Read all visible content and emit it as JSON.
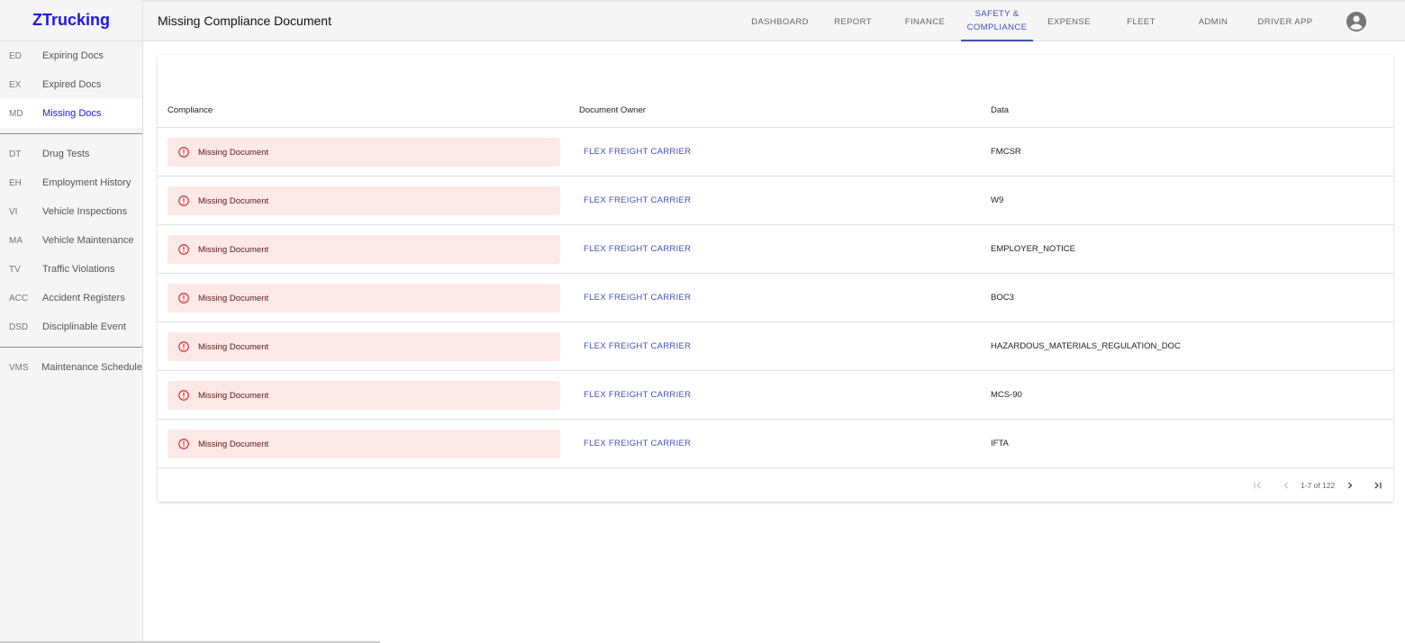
{
  "app": {
    "brand": "ZTrucking"
  },
  "header": {
    "title": "Missing Compliance Document",
    "nav": [
      {
        "label": "DASHBOARD"
      },
      {
        "label": "REPORT"
      },
      {
        "label": "FINANCE"
      },
      {
        "label": "SAFETY & COMPLIANCE",
        "line1": "SAFETY &",
        "line2": "COMPLIANCE",
        "active": true
      },
      {
        "label": "EXPENSE"
      },
      {
        "label": "FLEET"
      },
      {
        "label": "ADMIN"
      },
      {
        "label": "DRIVER APP"
      }
    ]
  },
  "sidebar": {
    "items": [
      {
        "abbr": "ED",
        "label": "Expiring Docs"
      },
      {
        "abbr": "EX",
        "label": "Expired Docs"
      },
      {
        "abbr": "MD",
        "label": "Missing Docs",
        "active": true
      },
      {
        "abbr": "DT",
        "label": "Drug Tests"
      },
      {
        "abbr": "EH",
        "label": "Employment History"
      },
      {
        "abbr": "VI",
        "label": "Vehicle Inspections"
      },
      {
        "abbr": "MA",
        "label": "Vehicle Maintenance"
      },
      {
        "abbr": "TV",
        "label": "Traffic Violations"
      },
      {
        "abbr": "ACC",
        "label": "Accident Registers"
      },
      {
        "abbr": "DSD",
        "label": "Disciplinable Event"
      },
      {
        "abbr": "VMS",
        "label": "Maintenance Schedule"
      }
    ]
  },
  "table": {
    "columns": [
      "Compliance",
      "Document Owner",
      "Data"
    ],
    "rows": [
      {
        "compliance": "Missing Document",
        "owner": "FLEX FREIGHT CARRIER",
        "data": "FMCSR"
      },
      {
        "compliance": "Missing Document",
        "owner": "FLEX FREIGHT CARRIER",
        "data": "W9"
      },
      {
        "compliance": "Missing Document",
        "owner": "FLEX FREIGHT CARRIER",
        "data": "EMPLOYER_NOTICE"
      },
      {
        "compliance": "Missing Document",
        "owner": "FLEX FREIGHT CARRIER",
        "data": "BOC3"
      },
      {
        "compliance": "Missing Document",
        "owner": "FLEX FREIGHT CARRIER",
        "data": "HAZARDOUS_MATERIALS_REGULATION_DOC"
      },
      {
        "compliance": "Missing Document",
        "owner": "FLEX FREIGHT CARRIER",
        "data": "MCS-90"
      },
      {
        "compliance": "Missing Document",
        "owner": "FLEX FREIGHT CARRIER",
        "data": "IFTA"
      }
    ]
  },
  "pagination": {
    "range": "1-7 of 122"
  },
  "colors": {
    "brand": "#1a1ae0",
    "accent": "#3f51b5",
    "error": "#d32f2f",
    "error_bg": "#fde8e8"
  },
  "icons": {
    "row_status": "error-outline-icon",
    "avatar": "account-circle-icon"
  }
}
